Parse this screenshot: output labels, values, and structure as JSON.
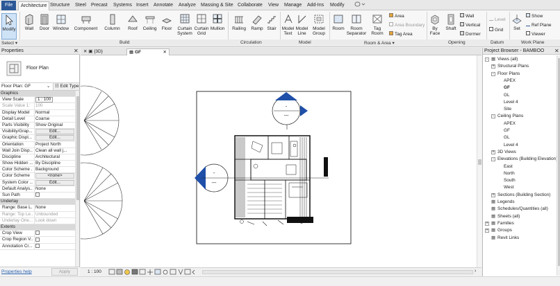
{
  "ribbon": {
    "tabs": [
      "File",
      "Architecture",
      "Structure",
      "Steel",
      "Precast",
      "Systems",
      "Insert",
      "Annotate",
      "Analyze",
      "Massing & Site",
      "Collaborate",
      "View",
      "Manage",
      "Add-Ins",
      "Modify"
    ],
    "active_tab": "Architecture",
    "buttons": {
      "modify": "Modify",
      "wall": "Wall",
      "door": "Door",
      "window": "Window",
      "component": "Component",
      "column": "Column",
      "roof": "Roof",
      "ceiling": "Ceiling",
      "floor": "Floor",
      "curtain_system_1": "Curtain",
      "curtain_system_2": "System",
      "curtain_grid_1": "Curtain",
      "curtain_grid_2": "Grid",
      "mullion": "Mullion",
      "railing": "Railing",
      "ramp": "Ramp",
      "stair": "Stair",
      "model_text_1": "Model",
      "model_text_2": "Text",
      "model_line_1": "Model",
      "model_line_2": "Line",
      "model_group_1": "Model",
      "model_group_2": "Group",
      "room": "Room",
      "room_sep_1": "Room",
      "room_sep_2": "Separator",
      "tag_room_1": "Tag",
      "tag_room_2": "Room",
      "area": "Area",
      "area_boundary": "Area  Boundary",
      "tag_area": "Tag  Area",
      "by_face_1": "By",
      "by_face_2": "Face",
      "shaft": "Shaft",
      "wall_open": "Wall",
      "vertical": "Vertical",
      "dormer": "Dormer",
      "level": "Level",
      "grid": "Grid",
      "set": "Set",
      "show": "Show",
      "ref_plane": "Ref  Plane",
      "viewer": "Viewer"
    },
    "panels": {
      "select": "Select",
      "build": "Build",
      "circulation": "Circulation",
      "model": "Model",
      "room_area": "Room & Area",
      "opening": "Opening",
      "datum": "Datum",
      "work_plane": "Work Plane"
    }
  },
  "properties": {
    "title": "Properties",
    "type_name": "Floor Plan",
    "selector": "Floor Plan: GF",
    "edit_type": "Edit Type",
    "rows": [
      {
        "k": "Graphics",
        "v": "",
        "kind": "sect"
      },
      {
        "k": "View Scale",
        "v": "1 : 100",
        "kind": "box"
      },
      {
        "k": "Scale Value  1:",
        "v": "100",
        "kind": "grey"
      },
      {
        "k": "Display Model",
        "v": "Normal",
        "kind": ""
      },
      {
        "k": "Detail Level",
        "v": "Coarse",
        "kind": ""
      },
      {
        "k": "Parts Visibility",
        "v": "Show Original",
        "kind": ""
      },
      {
        "k": "Visibility/Grap...",
        "v": "Edit...",
        "kind": "btn"
      },
      {
        "k": "Graphic Displ...",
        "v": "Edit...",
        "kind": "btn"
      },
      {
        "k": "Orientation",
        "v": "Project North",
        "kind": ""
      },
      {
        "k": "Wall Join Disp...",
        "v": "Clean all wall j...",
        "kind": ""
      },
      {
        "k": "Discipline",
        "v": "Architectural",
        "kind": ""
      },
      {
        "k": "Show Hidden ...",
        "v": "By Discipline",
        "kind": ""
      },
      {
        "k": "Color Scheme ...",
        "v": "Background",
        "kind": ""
      },
      {
        "k": "Color Scheme",
        "v": "<none>",
        "kind": "btn"
      },
      {
        "k": "System Color ...",
        "v": "Edit...",
        "kind": "btn"
      },
      {
        "k": "Default Analys...",
        "v": "None",
        "kind": ""
      },
      {
        "k": "Sun Path",
        "v": "",
        "kind": "chk"
      },
      {
        "k": "Underlay",
        "v": "",
        "kind": "sect"
      },
      {
        "k": "Range: Base L...",
        "v": "None",
        "kind": ""
      },
      {
        "k": "Range: Top Le...",
        "v": "Unbounded",
        "kind": "grey"
      },
      {
        "k": "Underlay Orie...",
        "v": "Look down",
        "kind": "grey"
      },
      {
        "k": "Extents",
        "v": "",
        "kind": "sect"
      },
      {
        "k": "Crop View",
        "v": "",
        "kind": "chk"
      },
      {
        "k": "Crop Region V...",
        "v": "",
        "kind": "chk"
      },
      {
        "k": "Annotation Cr...",
        "v": "",
        "kind": "chk"
      }
    ],
    "help_link": "Properties help",
    "apply": "Apply"
  },
  "view_tabs": [
    {
      "label": "{3D}",
      "active": false
    },
    {
      "label": "GF",
      "active": true
    }
  ],
  "plan": {
    "top_tag_top": "-",
    "top_tag_bottom": "---",
    "left_tag_top": "-",
    "left_tag_bottom": "---"
  },
  "status": {
    "scale": "1 : 100"
  },
  "browser": {
    "title": "Project Browser - BAMBOO",
    "nodes": [
      {
        "label": "Views (all)",
        "indent": 0,
        "exp": "-",
        "icon": true,
        "bold": false
      },
      {
        "label": "Structural Plans",
        "indent": 1,
        "exp": "+",
        "icon": false,
        "bold": false
      },
      {
        "label": "Floor Plans",
        "indent": 1,
        "exp": "-",
        "icon": false,
        "bold": false
      },
      {
        "label": "APEX",
        "indent": 2,
        "exp": "",
        "icon": false,
        "bold": false
      },
      {
        "label": "GF",
        "indent": 2,
        "exp": "",
        "icon": false,
        "bold": true
      },
      {
        "label": "GL",
        "indent": 2,
        "exp": "",
        "icon": false,
        "bold": false
      },
      {
        "label": "Level 4",
        "indent": 2,
        "exp": "",
        "icon": false,
        "bold": false
      },
      {
        "label": "Site",
        "indent": 2,
        "exp": "",
        "icon": false,
        "bold": false
      },
      {
        "label": "Ceiling Plans",
        "indent": 1,
        "exp": "-",
        "icon": false,
        "bold": false
      },
      {
        "label": "APEX",
        "indent": 2,
        "exp": "",
        "icon": false,
        "bold": false
      },
      {
        "label": "GF",
        "indent": 2,
        "exp": "",
        "icon": false,
        "bold": false
      },
      {
        "label": "GL",
        "indent": 2,
        "exp": "",
        "icon": false,
        "bold": false
      },
      {
        "label": "Level 4",
        "indent": 2,
        "exp": "",
        "icon": false,
        "bold": false
      },
      {
        "label": "3D Views",
        "indent": 1,
        "exp": "+",
        "icon": false,
        "bold": false
      },
      {
        "label": "Elevations (Building Elevation)",
        "indent": 1,
        "exp": "-",
        "icon": false,
        "bold": false
      },
      {
        "label": "East",
        "indent": 2,
        "exp": "",
        "icon": false,
        "bold": false
      },
      {
        "label": "North",
        "indent": 2,
        "exp": "",
        "icon": false,
        "bold": false
      },
      {
        "label": "South",
        "indent": 2,
        "exp": "",
        "icon": false,
        "bold": false
      },
      {
        "label": "West",
        "indent": 2,
        "exp": "",
        "icon": false,
        "bold": false
      },
      {
        "label": "Sections (Building Section)",
        "indent": 1,
        "exp": "+",
        "icon": false,
        "bold": false
      },
      {
        "label": "Legends",
        "indent": 0,
        "exp": "",
        "icon": true,
        "bold": false
      },
      {
        "label": "Schedules/Quantities (all)",
        "indent": 0,
        "exp": "",
        "icon": true,
        "bold": false
      },
      {
        "label": "Sheets (all)",
        "indent": 0,
        "exp": "",
        "icon": true,
        "bold": false
      },
      {
        "label": "Families",
        "indent": 0,
        "exp": "+",
        "icon": true,
        "bold": false
      },
      {
        "label": "Groups",
        "indent": 0,
        "exp": "+",
        "icon": true,
        "bold": false
      },
      {
        "label": "Revit Links",
        "indent": 0,
        "exp": "",
        "icon": true,
        "bold": false
      }
    ]
  },
  "colors": {
    "file_tab": "#2b5797",
    "elevation_marker": "#1f4fa8",
    "selection": "#cfe3f7"
  }
}
